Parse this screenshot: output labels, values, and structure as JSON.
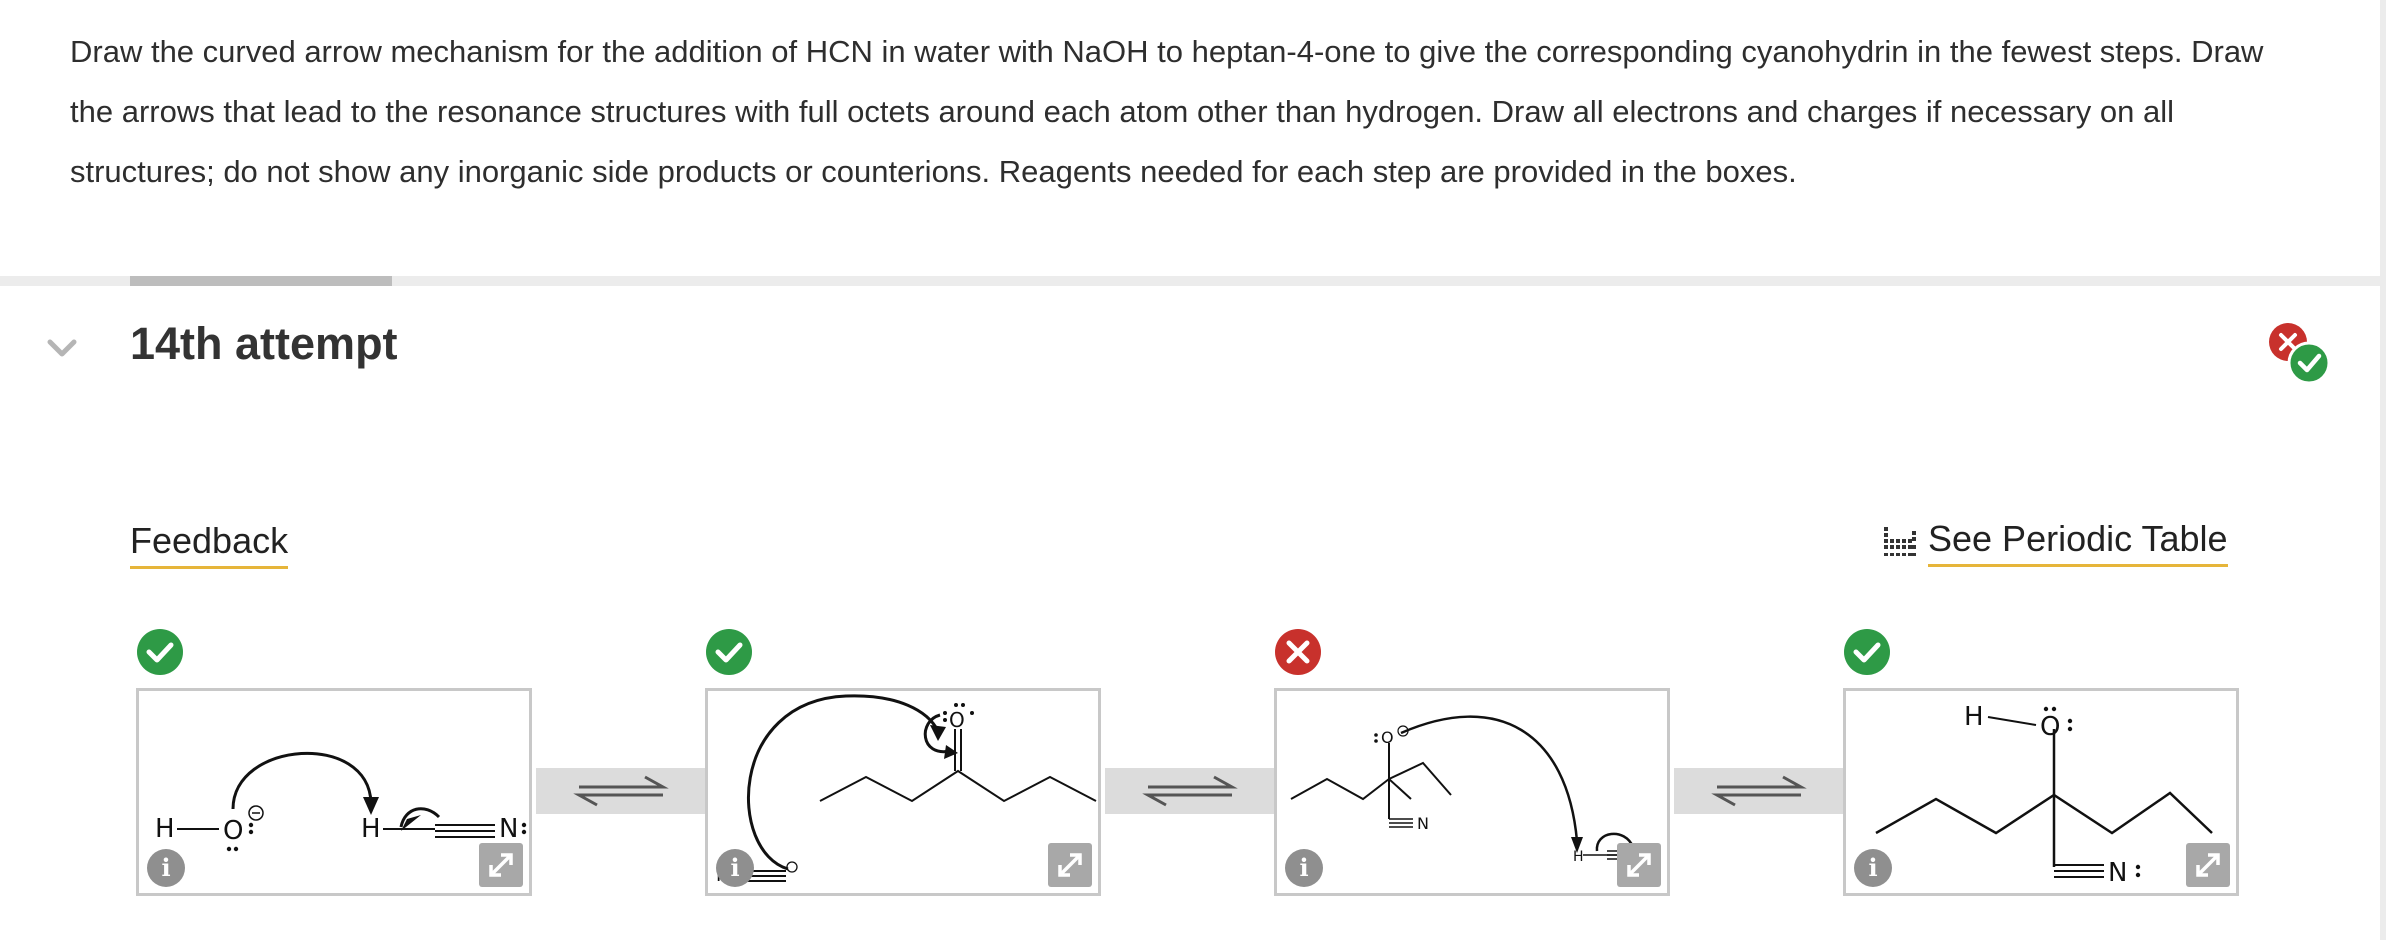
{
  "question": {
    "text": "Draw the curved arrow mechanism for the addition of HCN in water with NaOH to heptan-4-one to give the corresponding cyanohydrin in the fewest steps. Draw the arrows that lead to the resonance structures with full octets around each atom other than hydrogen. Draw all electrons and charges if necessary on all structures; do not show any inorganic side products or counterions. Reagents needed for each step are provided in the boxes."
  },
  "attempt": {
    "title": "14th attempt",
    "status": "partially-correct"
  },
  "links": {
    "feedback": "Feedback",
    "periodic_table": "See Periodic Table"
  },
  "steps": [
    {
      "status": "correct",
      "labels": [
        "H",
        "O",
        "H",
        "N"
      ]
    },
    {
      "status": "correct",
      "labels": [
        "O",
        "N"
      ]
    },
    {
      "status": "incorrect",
      "labels": [
        "O",
        "N",
        "H"
      ]
    },
    {
      "status": "correct",
      "labels": [
        "H",
        "O",
        "N"
      ]
    }
  ],
  "colors": {
    "correct": "#2e9a46",
    "incorrect": "#c8312c",
    "accent_underline": "#e6b53a"
  }
}
